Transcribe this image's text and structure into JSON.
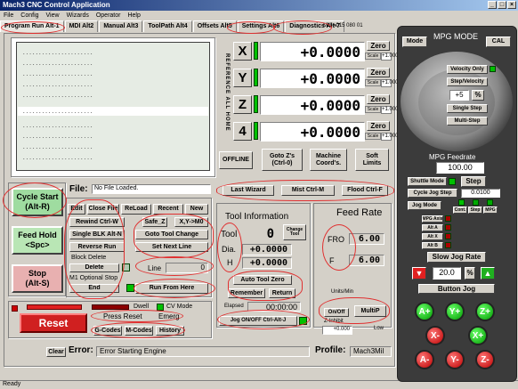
{
  "window": {
    "title": "Mach3 CNC Control Application"
  },
  "menu": [
    "File",
    "Config",
    "View",
    "Wizards",
    "Operator",
    "Help"
  ],
  "tabs": [
    "Program Run Alt-1",
    "MDI Alt2",
    "Manual Alt3",
    "ToolPath Alt4",
    "Offsets Alt5",
    "Settings Alt6",
    "Diagnostics Alt-7"
  ],
  "status_top": "Mill->015  080 01",
  "reference": "REFERENCE ALL HOME",
  "axes": [
    {
      "label": "X",
      "value": "+0.0000"
    },
    {
      "label": "Y",
      "value": "+0.0000"
    },
    {
      "label": "Z",
      "value": "+0.0000"
    },
    {
      "label": "4",
      "value": "+0.0000"
    }
  ],
  "zero_label": "Zero",
  "scale_label": "Scale",
  "scale_value": "+1.0000",
  "dro_buttons": {
    "offline": "OFFLINE",
    "goto_z": "Goto Z's\n(Ctrl-0)",
    "machine": "Machine\nCoord's.",
    "soft_limits": "Soft\nLimits"
  },
  "file": {
    "label": "File:",
    "value": "No File Loaded."
  },
  "left_controls": {
    "cycle_start": "Cycle Start\n(Alt-R)",
    "feed_hold": "Feed Hold\n<Spc>",
    "stop": "Stop\n(Alt-S)",
    "reset": "Reset"
  },
  "program_buttons": {
    "edit": "Edit",
    "close_file": "Close File",
    "reload": "ReLoad",
    "recent": "Recent",
    "new": "New",
    "rewind": "Rewind Ctrl-W",
    "single_blk": "Single BLK Alt-N",
    "reverse_run": "Reverse Run",
    "block_delete": "Block Delete",
    "delete": "Delete",
    "optional_stop": "M1 Optional Stop",
    "end": "End",
    "safe_z": "Safe_Z",
    "xy_m0": "X,Y->M0",
    "goto_tool_change": "Goto Tool Change",
    "set_next_line": "Set Next Line",
    "line_label": "Line",
    "line_value": "0",
    "run_from_here": "Run From Here"
  },
  "wizards": {
    "last_wizard": "Last Wizard",
    "mist": "Mist Ctrl-M",
    "flood": "Flood Ctrl-F"
  },
  "tool_info": {
    "title": "Tool Information",
    "tool_label": "Tool",
    "tool_value": "0",
    "change_label": "Change\nTool",
    "dia_label": "Dia.",
    "dia_value": "+0.0000",
    "h_label": "H",
    "h_value": "+0.0000",
    "auto_tool_zero": "Auto Tool Zero",
    "remember": "Remember",
    "return": "Return",
    "elapsed_label": "Elapsed",
    "elapsed_value": "00:00:00",
    "jog_onoff": "Jog ON/OFF Ctrl-Alt-J"
  },
  "feed_rate": {
    "title": "Feed Rate",
    "fro_label": "FRO",
    "fro_value": "6.00",
    "f_label": "F",
    "f_value": "6.00",
    "units": "Units/Min",
    "onoff": "On/Off",
    "z_inhibit": "Z-Inhibit",
    "z_inhibit_value": "+0.000",
    "multi": "MultiP",
    "low": "Low"
  },
  "status_panel": {
    "dwell": "Dwell",
    "cv_mode": "CV Mode",
    "press_reset": "Press Reset",
    "emerg": "Emerg",
    "gcodes": "G-Codes",
    "mcodes": "M-Codes",
    "history": "History"
  },
  "bottom": {
    "clear": "Clear",
    "error_label": "Error:",
    "error_value": "Error Starting Engine",
    "profile_label": "Profile:",
    "profile_value": "Mach3Mil",
    "status": "Ready"
  },
  "mpg": {
    "title": "MPG MODE",
    "mode": "Mode",
    "cal": "CAL",
    "velocity_only": "Velocity Only",
    "step_velocity": "Step/Velocity",
    "plus5": "+5",
    "percent": "%",
    "single_step": "Single Step",
    "multi_step": "Multi-Step",
    "feedrate_label": "MPG Feedrate",
    "feedrate_value": "100.00",
    "shuttle_mode": "Shuttle Mode",
    "step": "Step",
    "cycle_jog_step": "Cycle Jog Step",
    "cycle_jog_value": "0.0100",
    "jog_mode": "Jog Mode",
    "cont": "Cont.",
    "step2": "Step",
    "mpg2": "MPG",
    "mpg_axes": [
      "MPG Axis",
      "Alt A",
      "Alt X",
      "Alt B"
    ],
    "slow_jog": "Slow Jog Rate",
    "slow_jog_value": "20.0",
    "slow_jog_pct": "%",
    "button_jog": "Button Jog",
    "jog_labels": {
      "a_plus": "A+",
      "y_plus": "Y+",
      "z_plus": "Z+",
      "x_minus": "X-",
      "x_plus": "X+",
      "a_minus": "A-",
      "y_minus": "Y-",
      "z_minus": "Z-"
    }
  }
}
